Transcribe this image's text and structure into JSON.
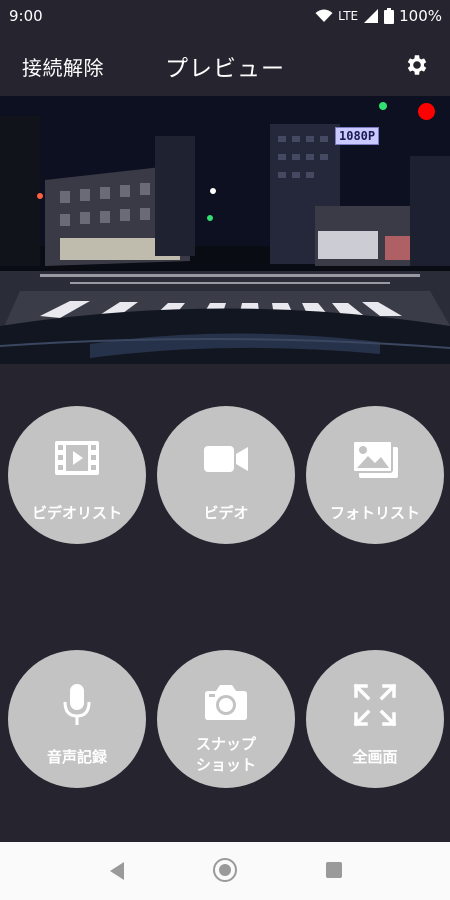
{
  "status": {
    "time": "9:00",
    "network": "LTE",
    "battery": "100%"
  },
  "header": {
    "disconnect_label": "接続解除",
    "title": "プレビュー"
  },
  "preview": {
    "resolution_badge": "1080P",
    "recording": true
  },
  "actions": {
    "video_list": "ビデオリスト",
    "video": "ビデオ",
    "photo_list": "フォトリスト",
    "audio_record": "音声記録",
    "snapshot_line1": "スナップ",
    "snapshot_line2": "ショット",
    "fullscreen": "全画面"
  },
  "icons": {
    "settings": "gear-icon",
    "video_list": "film-icon",
    "video": "video-camera-icon",
    "photo_list": "photo-gallery-icon",
    "audio_record": "microphone-icon",
    "snapshot": "camera-icon",
    "fullscreen": "expand-icon"
  },
  "colors": {
    "background": "#26242f",
    "button": "#c3c3c3",
    "rec": "#ff0000",
    "nav_bar": "#fafafa"
  }
}
